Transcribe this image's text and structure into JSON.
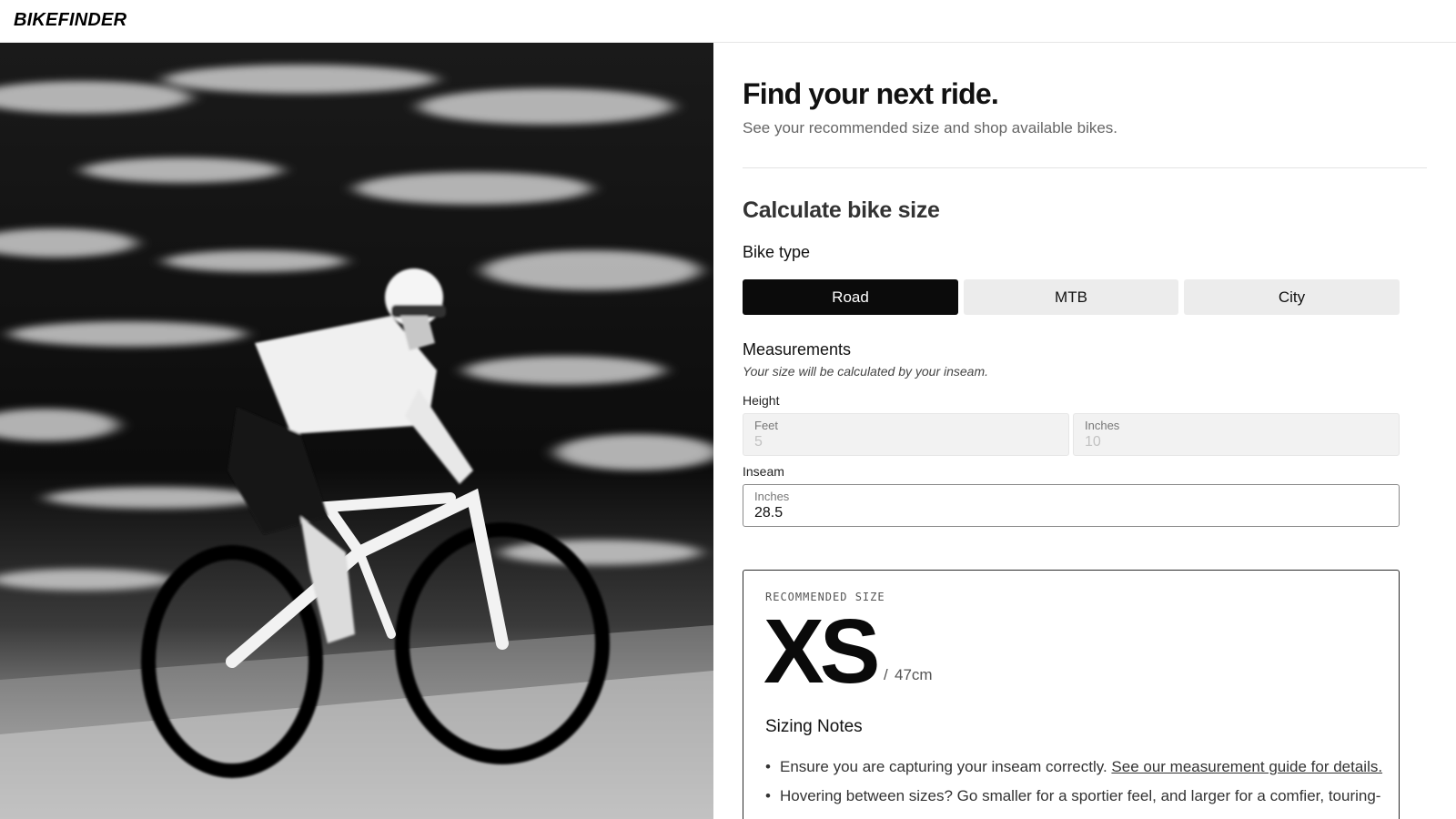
{
  "header": {
    "logo": "BIKEFINDER"
  },
  "hero": {
    "image_description_icon": "cyclist-photo"
  },
  "main": {
    "title": "Find your next ride.",
    "subtitle": "See your recommended size and shop available bikes.",
    "calc_title": "Calculate bike size",
    "bike_type": {
      "label": "Bike type",
      "options": [
        "Road",
        "MTB",
        "City"
      ],
      "selected": "Road"
    },
    "measurements": {
      "title": "Measurements",
      "note": "Your size will be calculated by your inseam.",
      "height": {
        "label": "Height",
        "feet_label": "Feet",
        "feet_placeholder": "5",
        "inches_label": "Inches",
        "inches_placeholder": "10"
      },
      "inseam": {
        "label": "Inseam",
        "inches_label": "Inches",
        "value": "28.5"
      }
    },
    "result": {
      "label": "RECOMMENDED SIZE",
      "size": "XS",
      "slash": "/",
      "cm": "47cm",
      "notes_title": "Sizing Notes",
      "notes": [
        {
          "text": "Ensure you are capturing your inseam correctly. ",
          "link": "See our measurement guide for details."
        },
        {
          "text": "Hovering between sizes? Go smaller for a sportier feel, and larger for a comfier, touring-"
        }
      ]
    }
  },
  "colors": {
    "selected_bg": "#0b0b0b",
    "unselected_bg": "#ececec",
    "disabled_field_bg": "#f2f2f2"
  }
}
